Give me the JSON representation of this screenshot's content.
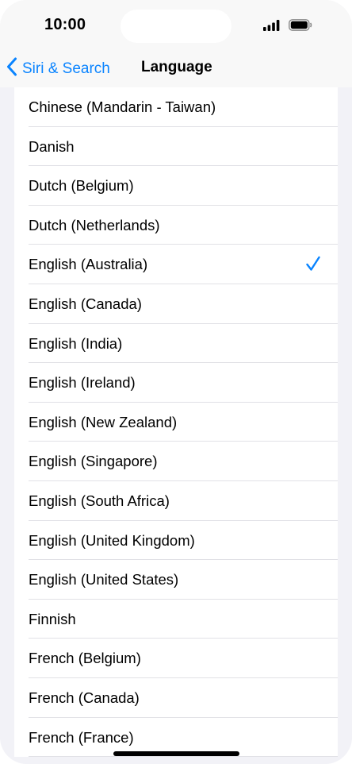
{
  "status": {
    "time": "10:00"
  },
  "nav": {
    "back_label": "Siri & Search",
    "title": "Language"
  },
  "languages": [
    {
      "label": "Chinese (Mandarin - Taiwan)",
      "selected": false
    },
    {
      "label": "Danish",
      "selected": false
    },
    {
      "label": "Dutch (Belgium)",
      "selected": false
    },
    {
      "label": "Dutch (Netherlands)",
      "selected": false
    },
    {
      "label": "English (Australia)",
      "selected": true
    },
    {
      "label": "English (Canada)",
      "selected": false
    },
    {
      "label": "English (India)",
      "selected": false
    },
    {
      "label": "English (Ireland)",
      "selected": false
    },
    {
      "label": "English (New Zealand)",
      "selected": false
    },
    {
      "label": "English (Singapore)",
      "selected": false
    },
    {
      "label": "English (South Africa)",
      "selected": false
    },
    {
      "label": "English (United Kingdom)",
      "selected": false
    },
    {
      "label": "English (United States)",
      "selected": false
    },
    {
      "label": "Finnish",
      "selected": false
    },
    {
      "label": "French (Belgium)",
      "selected": false
    },
    {
      "label": "French (Canada)",
      "selected": false
    },
    {
      "label": "French (France)",
      "selected": false
    }
  ],
  "colors": {
    "accent": "#0a84ff",
    "background": "#f2f2f7"
  },
  "icons": {
    "back": "chevron-left-icon",
    "check": "checkmark-icon",
    "signal": "cellular-signal-icon",
    "battery": "battery-icon"
  }
}
